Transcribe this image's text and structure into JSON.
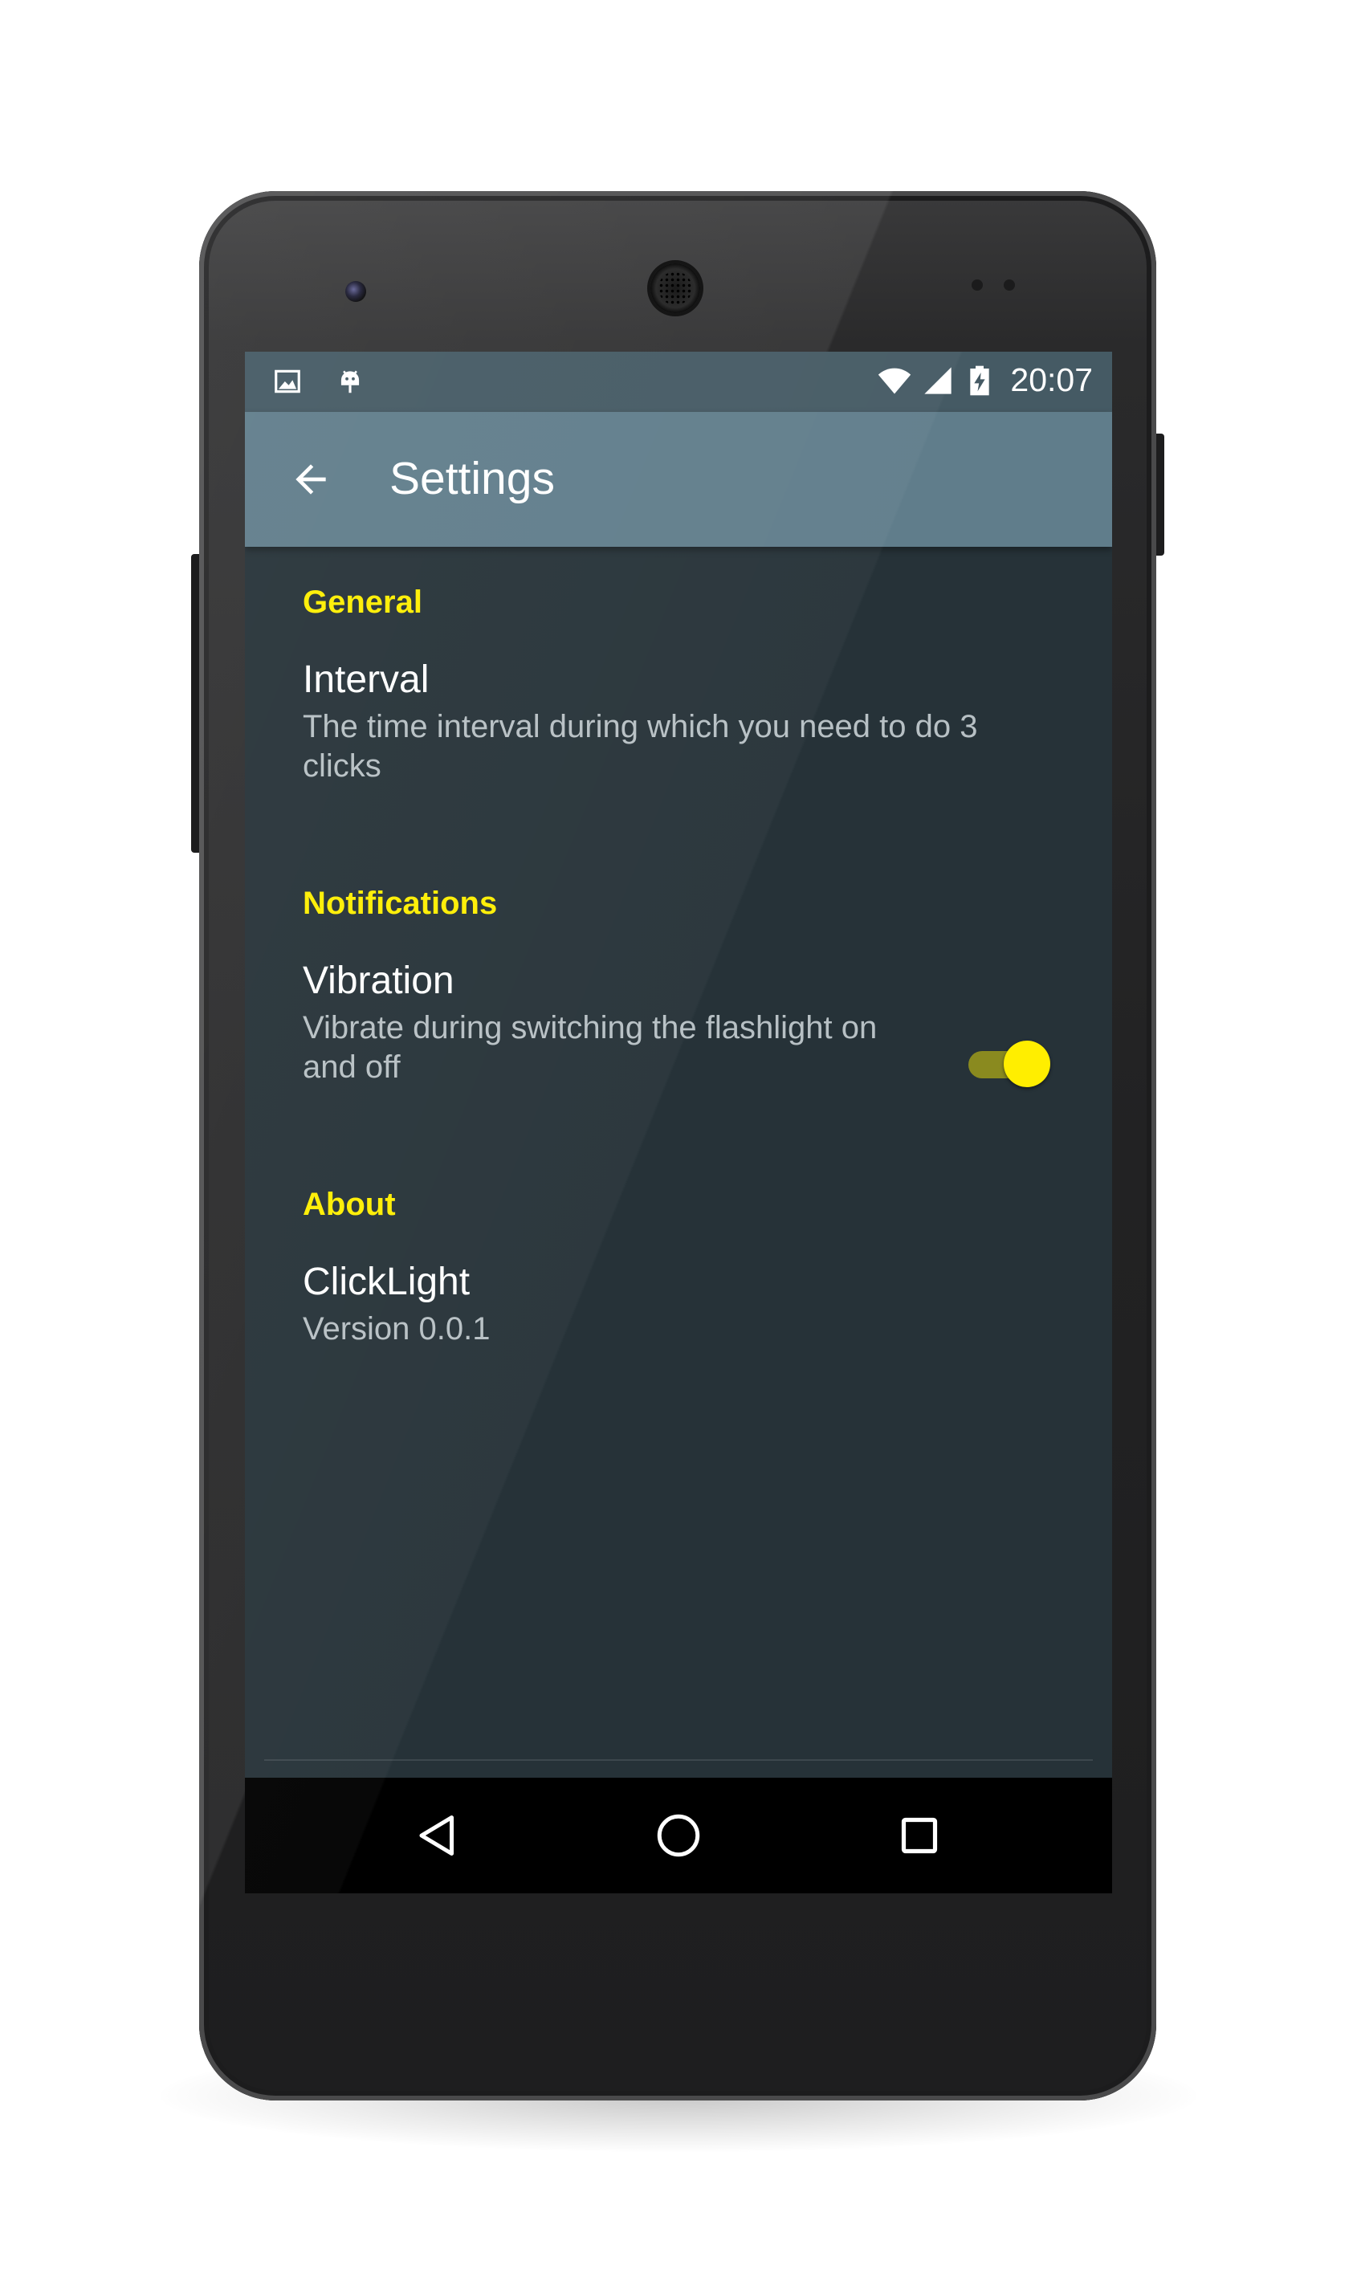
{
  "status_bar": {
    "left_icons": [
      "image-icon",
      "android-debug-icon"
    ],
    "right_icons": [
      "wifi-icon",
      "cell-signal-icon",
      "battery-charging-icon"
    ],
    "time": "20:07"
  },
  "app_bar": {
    "back_icon": "arrow-back-icon",
    "title": "Settings"
  },
  "preferences": {
    "general": {
      "header": "General",
      "interval": {
        "title": "Interval",
        "summary": "The time interval during which you need to do 3 clicks"
      }
    },
    "notifications": {
      "header": "Notifications",
      "vibration": {
        "title": "Vibration",
        "summary": "Vibrate during switching the flashlight on and off",
        "enabled": true
      }
    },
    "about": {
      "header": "About",
      "app": {
        "title": "ClickLight",
        "summary": "Version 0.0.1"
      }
    }
  },
  "nav_bar": {
    "buttons": [
      "back-triangle-icon",
      "home-circle-icon",
      "recents-square-icon"
    ]
  },
  "colors": {
    "accent": "#ffee00",
    "app_bar": "#607d8b",
    "status_bar": "#455a64",
    "background": "#263238"
  }
}
